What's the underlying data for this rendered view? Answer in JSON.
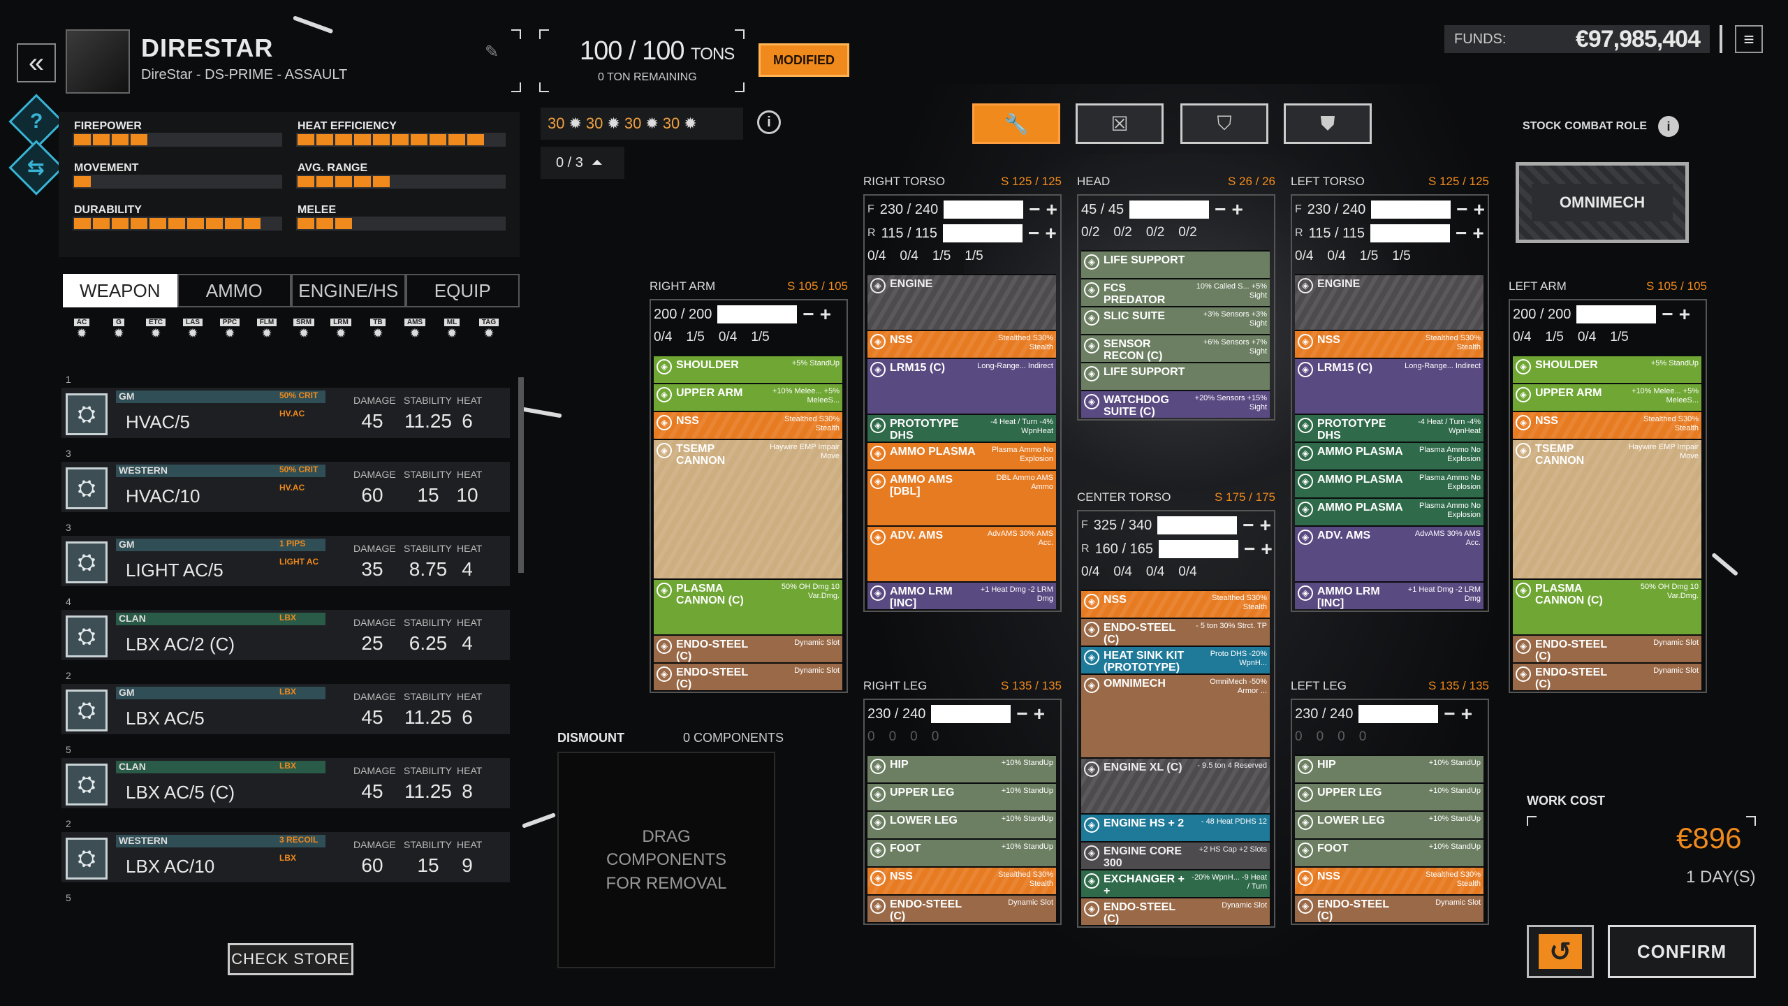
{
  "mech": {
    "name": "DIRESTAR",
    "subtitle": "DireStar - DS-PRIME - ASSAULT"
  },
  "stats": [
    {
      "label": "FIREPOWER",
      "segments": 4
    },
    {
      "label": "HEAT EFFICIENCY",
      "segments": 10
    },
    {
      "label": "MOVEMENT",
      "segments": 1
    },
    {
      "label": "AVG. RANGE",
      "segments": 5
    },
    {
      "label": "DURABILITY",
      "segments": 10
    },
    {
      "label": "MELEE",
      "segments": 3
    }
  ],
  "tabs": [
    "WEAPON",
    "AMMO",
    "ENGINE/HS",
    "EQUIP"
  ],
  "filters": [
    "AC",
    "G",
    "ETC",
    "LAS",
    "PPC",
    "FLM",
    "SRM",
    "LRM",
    "TB",
    "AMS",
    "ML",
    "TAG"
  ],
  "weapons": [
    {
      "count": "1",
      "mfr": "GM",
      "mfr_type": "is",
      "tag1": "50% CRIT",
      "tag2": "HV.AC",
      "name": "HVAC/5",
      "damage": "45",
      "stability": "11.25",
      "heat": "6"
    },
    {
      "count": "3",
      "mfr": "WESTERN",
      "mfr_type": "is",
      "tag1": "50% CRIT",
      "tag2": "HV.AC",
      "name": "HVAC/10",
      "damage": "60",
      "stability": "15",
      "heat": "10"
    },
    {
      "count": "3",
      "mfr": "GM",
      "mfr_type": "is",
      "tag1": "1 PIPS",
      "tag2": "LIGHT AC",
      "name": "LIGHT AC/5",
      "damage": "35",
      "stability": "8.75",
      "heat": "4"
    },
    {
      "count": "4",
      "mfr": "CLAN",
      "mfr_type": "clan",
      "tag1": "LBX",
      "tag2": "",
      "name": "LBX AC/2 (C)",
      "damage": "25",
      "stability": "6.25",
      "heat": "4"
    },
    {
      "count": "2",
      "mfr": "GM",
      "mfr_type": "is",
      "tag1": "LBX",
      "tag2": "",
      "name": "LBX AC/5",
      "damage": "45",
      "stability": "11.25",
      "heat": "6"
    },
    {
      "count": "5",
      "mfr": "CLAN",
      "mfr_type": "clan",
      "tag1": "LBX",
      "tag2": "",
      "name": "LBX AC/5 (C)",
      "damage": "45",
      "stability": "11.25",
      "heat": "8"
    },
    {
      "count": "2",
      "mfr": "WESTERN",
      "mfr_type": "is",
      "tag1": "3 RECOIL",
      "tag2": "LBX",
      "name": "LBX AC/10",
      "damage": "60",
      "stability": "15",
      "heat": "9"
    }
  ],
  "weapon_list_tail_count": "5",
  "weapon_headers": {
    "damage": "DAMAGE",
    "stability": "STABILITY",
    "heat": "HEAT"
  },
  "check_store": "CHECK STORE",
  "tonnage": {
    "value": "100 / 100",
    "unit": "TONS",
    "remaining": "0 TON REMAINING"
  },
  "modified": "MODIFIED",
  "hardpoints": [
    "30",
    "30",
    "30",
    "30"
  ],
  "jump": "0 / 3",
  "funds": {
    "label": "FUNDS:",
    "value": "€97,985,404"
  },
  "stock_role": {
    "label": "STOCK COMBAT ROLE",
    "value": "OMNIMECH"
  },
  "dismount": {
    "label": "DISMOUNT",
    "components": "0 COMPONENTS",
    "hint": "DRAG COMPONENTS FOR REMOVAL"
  },
  "work_cost": {
    "label": "WORK COST",
    "value": "€896",
    "days": "1 DAY(S)"
  },
  "confirm": "CONFIRM",
  "locations": {
    "right_arm": {
      "name": "RIGHT ARM",
      "slots": "S 105 / 105",
      "armor": "200 / 200",
      "hardpoints": [
        "0/4",
        "1/5",
        "0/4",
        "1/5"
      ],
      "items": [
        {
          "n": "SHOULDER",
          "d": "+5% StandUp",
          "c": "c-lime",
          "h": 1
        },
        {
          "n": "UPPER ARM",
          "d": "+10% Melee... +5% MeleeS...",
          "c": "c-lime",
          "h": 1
        },
        {
          "n": "NSS",
          "d": "Stealthed S30% Stealth",
          "c": "c-orange stripe",
          "h": 1
        },
        {
          "n": "TSEMP CANNON",
          "d": "Haywire EMP Impair Move",
          "c": "c-tan stripe",
          "h": 5
        },
        {
          "n": "PLASMA CANNON (C)",
          "d": "50% OH Dmg 10 Var.Dmg.",
          "c": "c-lime",
          "h": 2
        },
        {
          "n": "ENDO-STEEL (C)",
          "d": "Dynamic Slot",
          "c": "c-brown",
          "h": 1
        },
        {
          "n": "ENDO-STEEL (C)",
          "d": "Dynamic Slot",
          "c": "c-brown",
          "h": 1
        }
      ]
    },
    "right_torso": {
      "name": "RIGHT TORSO",
      "slots": "S 125 / 125",
      "front": "230 / 240",
      "rear": "115 / 115",
      "hardpoints": [
        "0/4",
        "0/4",
        "1/5",
        "1/5"
      ],
      "items": [
        {
          "n": "ENGINE",
          "d": "",
          "c": "c-gray stripe",
          "h": 2
        },
        {
          "n": "NSS",
          "d": "Stealthed S30% Stealth",
          "c": "c-orange stripe",
          "h": 1
        },
        {
          "n": "LRM15 (C)",
          "d": "Long-Range... Indirect",
          "c": "c-purple",
          "h": 2
        },
        {
          "n": "PROTOTYPE DHS",
          "d": "-4 Heat / Turn -4% WpnHeat",
          "c": "c-green",
          "h": 1
        },
        {
          "n": "AMMO PLASMA",
          "d": "Plasma Ammo No Explosion",
          "c": "c-orange",
          "h": 1
        },
        {
          "n": "AMMO AMS [DBL]",
          "d": "DBL Ammo AMS Ammo",
          "c": "c-orange",
          "h": 2
        },
        {
          "n": "ADV. AMS",
          "d": "AdvAMS 30% AMS Acc.",
          "c": "c-orange",
          "h": 2
        },
        {
          "n": "AMMO LRM [INC]",
          "d": "+1 Heat Dmg -2 LRM Dmg",
          "c": "c-purple",
          "h": 1
        }
      ]
    },
    "head": {
      "name": "HEAD",
      "slots": "S 26 / 26",
      "armor": "45 / 45",
      "hardpoints": [
        "0/2",
        "0/2",
        "0/2",
        "0/2"
      ],
      "items": [
        {
          "n": "LIFE SUPPORT",
          "d": "",
          "c": "c-sage",
          "h": 1
        },
        {
          "n": "FCS PREDATOR",
          "d": "10% Called S... +5% Sight",
          "c": "c-sage",
          "h": 1
        },
        {
          "n": "SLIC SUITE",
          "d": "+3% Sensors +3% Sight",
          "c": "c-sage",
          "h": 1
        },
        {
          "n": "SENSOR RECON (C)",
          "d": "+6% Sensors +7% Sight",
          "c": "c-sage",
          "h": 1
        },
        {
          "n": "LIFE SUPPORT",
          "d": "",
          "c": "c-sage",
          "h": 1
        },
        {
          "n": "WATCHDOG SUITE (C)",
          "d": "+20% Sensors +15% Sight",
          "c": "c-purple",
          "h": 1
        }
      ]
    },
    "center_torso": {
      "name": "CENTER TORSO",
      "slots": "S 175 / 175",
      "front": "325 / 340",
      "rear": "160 / 165",
      "hardpoints": [
        "0/4",
        "0/4",
        "0/4",
        "0/4"
      ],
      "items": [
        {
          "n": "NSS",
          "d": "Stealthed S30% Stealth",
          "c": "c-orange stripe",
          "h": 1
        },
        {
          "n": "ENDO-STEEL (C)",
          "d": "- 5 ton 30% Strct. TP",
          "c": "c-brown",
          "h": 1
        },
        {
          "n": "HEAT SINK KIT (PROTOTYPE)",
          "d": "Proto DHS -20% WpnH...",
          "c": "c-blue",
          "h": 1
        },
        {
          "n": "OMNIMECH",
          "d": "OmniMech -50% Armor ...",
          "c": "c-brown",
          "h": 3
        },
        {
          "n": "ENGINE XL (C)",
          "d": "- 9.5 ton 4 Reserved",
          "c": "c-gray stripe",
          "h": 2
        },
        {
          "n": "ENGINE HS + 2",
          "d": "- 48 Heat PDHS 12",
          "c": "c-blue",
          "h": 1
        },
        {
          "n": "ENGINE CORE 300",
          "d": "+2 HS Cap +2 Slots",
          "c": "c-gray",
          "h": 1
        },
        {
          "n": "EXCHANGER + +",
          "d": "-20% WpnH... -9 Heat / Turn",
          "c": "c-green",
          "h": 1
        },
        {
          "n": "ENDO-STEEL (C)",
          "d": "Dynamic Slot",
          "c": "c-brown",
          "h": 1
        }
      ]
    },
    "left_torso": {
      "name": "LEFT TORSO",
      "slots": "S 125 / 125",
      "front": "230 / 240",
      "rear": "115 / 115",
      "hardpoints": [
        "0/4",
        "0/4",
        "1/5",
        "1/5"
      ],
      "items": [
        {
          "n": "ENGINE",
          "d": "",
          "c": "c-gray stripe",
          "h": 2
        },
        {
          "n": "NSS",
          "d": "Stealthed S30% Stealth",
          "c": "c-orange stripe",
          "h": 1
        },
        {
          "n": "LRM15 (C)",
          "d": "Long-Range... Indirect",
          "c": "c-purple",
          "h": 2
        },
        {
          "n": "PROTOTYPE DHS",
          "d": "-4 Heat / Turn -4% WpnHeat",
          "c": "c-green",
          "h": 1
        },
        {
          "n": "AMMO PLASMA",
          "d": "Plasma Ammo No Explosion",
          "c": "c-green",
          "h": 1
        },
        {
          "n": "AMMO PLASMA",
          "d": "Plasma Ammo No Explosion",
          "c": "c-green",
          "h": 1
        },
        {
          "n": "AMMO PLASMA",
          "d": "Plasma Ammo No Explosion",
          "c": "c-green",
          "h": 1
        },
        {
          "n": "ADV. AMS",
          "d": "AdvAMS 30% AMS Acc.",
          "c": "c-purple",
          "h": 2
        },
        {
          "n": "AMMO LRM [INC]",
          "d": "+1 Heat Dmg -2 LRM Dmg",
          "c": "c-purple",
          "h": 1
        }
      ]
    },
    "left_arm": {
      "name": "LEFT ARM",
      "slots": "S 105 / 105",
      "armor": "200 / 200",
      "hardpoints": [
        "0/4",
        "1/5",
        "0/4",
        "1/5"
      ],
      "items": [
        {
          "n": "SHOULDER",
          "d": "+5% StandUp",
          "c": "c-lime",
          "h": 1
        },
        {
          "n": "UPPER ARM",
          "d": "+10% Melee... +5% MeleeS...",
          "c": "c-lime",
          "h": 1
        },
        {
          "n": "NSS",
          "d": "Stealthed S30% Stealth",
          "c": "c-orange stripe",
          "h": 1
        },
        {
          "n": "TSEMP CANNON",
          "d": "Haywire EMP Impair Move",
          "c": "c-tan stripe",
          "h": 5
        },
        {
          "n": "PLASMA CANNON (C)",
          "d": "50% OH Dmg 10 Var.Dmg.",
          "c": "c-lime",
          "h": 2
        },
        {
          "n": "ENDO-STEEL (C)",
          "d": "Dynamic Slot",
          "c": "c-brown",
          "h": 1
        },
        {
          "n": "ENDO-STEEL (C)",
          "d": "Dynamic Slot",
          "c": "c-brown",
          "h": 1
        }
      ]
    },
    "right_leg": {
      "name": "RIGHT LEG",
      "slots": "S 135 / 135",
      "armor": "230 / 240",
      "hardpoints": [
        "0",
        "0",
        "0",
        "0"
      ],
      "items": [
        {
          "n": "HIP",
          "d": "+10% StandUp",
          "c": "c-sage",
          "h": 1
        },
        {
          "n": "UPPER LEG",
          "d": "+10% StandUp",
          "c": "c-sage",
          "h": 1
        },
        {
          "n": "LOWER LEG",
          "d": "+10% StandUp",
          "c": "c-sage",
          "h": 1
        },
        {
          "n": "FOOT",
          "d": "+10% StandUp",
          "c": "c-sage",
          "h": 1
        },
        {
          "n": "NSS",
          "d": "Stealthed S30% Stealth",
          "c": "c-orange stripe",
          "h": 1
        },
        {
          "n": "ENDO-STEEL (C)",
          "d": "Dynamic Slot",
          "c": "c-brown",
          "h": 1
        }
      ]
    },
    "left_leg": {
      "name": "LEFT LEG",
      "slots": "S 135 / 135",
      "armor": "230 / 240",
      "hardpoints": [
        "0",
        "0",
        "0",
        "0"
      ],
      "items": [
        {
          "n": "HIP",
          "d": "+10% StandUp",
          "c": "c-sage",
          "h": 1
        },
        {
          "n": "UPPER LEG",
          "d": "+10% StandUp",
          "c": "c-sage",
          "h": 1
        },
        {
          "n": "LOWER LEG",
          "d": "+10% StandUp",
          "c": "c-sage",
          "h": 1
        },
        {
          "n": "FOOT",
          "d": "+10% StandUp",
          "c": "c-sage",
          "h": 1
        },
        {
          "n": "NSS",
          "d": "Stealthed S30% Stealth",
          "c": "c-orange stripe",
          "h": 1
        },
        {
          "n": "ENDO-STEEL (C)",
          "d": "Dynamic Slot",
          "c": "c-brown",
          "h": 1
        }
      ]
    }
  }
}
